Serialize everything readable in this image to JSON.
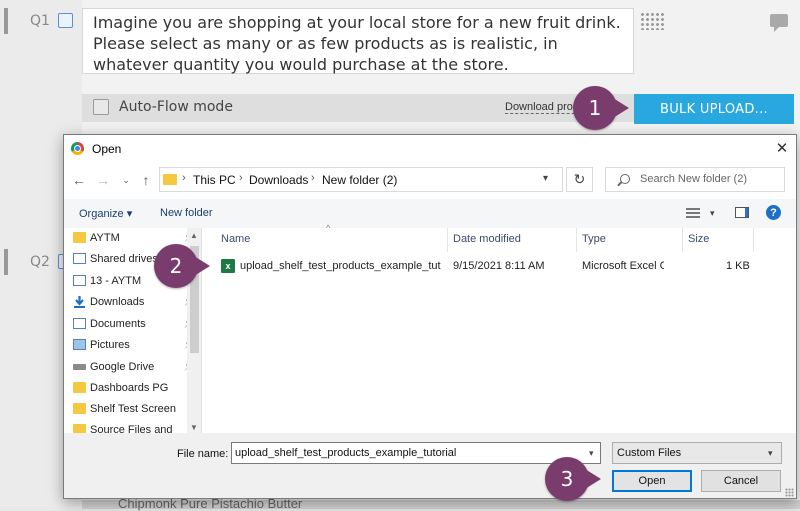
{
  "survey": {
    "q1_label": "Q1",
    "q2_label": "Q2",
    "question_text": "Imagine you are shopping at your local store for a new fruit drink. Please select as many or as few products as is realistic, in whatever quantity you would purchase at the store.",
    "autoflow_label": "Auto-Flow mode",
    "download_link": "Download products",
    "bulk_upload_label": "BULK UPLOAD...",
    "bottom_item": "Chipmonk Pure Pistachio Butter",
    "colors": {
      "bulk_button": "#29a8e0",
      "badge": "#7a3c6d"
    }
  },
  "callouts": [
    "1",
    "2",
    "3"
  ],
  "dialog": {
    "title": "Open",
    "breadcrumb": [
      "This PC",
      "Downloads",
      "New folder (2)"
    ],
    "search_placeholder": "Search New folder (2)",
    "toolbar": {
      "organize": "Organize",
      "new_folder": "New folder"
    },
    "nav_items": [
      {
        "label": "AYTM",
        "icon": "folder-icon",
        "pinned": true
      },
      {
        "label": "Shared drives",
        "icon": "doc-icon",
        "pinned": true
      },
      {
        "label": "13 - AYTM",
        "icon": "doc-icon",
        "pinned": true
      },
      {
        "label": "Downloads",
        "icon": "download-icon",
        "pinned": true
      },
      {
        "label": "Documents",
        "icon": "doc-icon",
        "pinned": true
      },
      {
        "label": "Pictures",
        "icon": "pictures-icon",
        "pinned": true
      },
      {
        "label": "Google Drive",
        "icon": "drive-icon",
        "pinned": true
      },
      {
        "label": "Dashboards PG",
        "icon": "folder-icon",
        "pinned": false
      },
      {
        "label": "Shelf Test Screen",
        "icon": "folder-icon",
        "pinned": false
      },
      {
        "label": "Source Files and",
        "icon": "folder-icon",
        "pinned": false
      }
    ],
    "columns": [
      "Name",
      "Date modified",
      "Type",
      "Size"
    ],
    "files": [
      {
        "name": "upload_shelf_test_products_example_tutorial",
        "date": "9/15/2021 8:11 AM",
        "type": "Microsoft Excel Comma Separated Values File",
        "size": "1 KB",
        "icon": "excel-icon"
      }
    ],
    "file_name_label": "File name:",
    "file_name_value": "upload_shelf_test_products_example_tutorial",
    "file_type": "Custom Files",
    "open_label": "Open",
    "cancel_label": "Cancel"
  }
}
